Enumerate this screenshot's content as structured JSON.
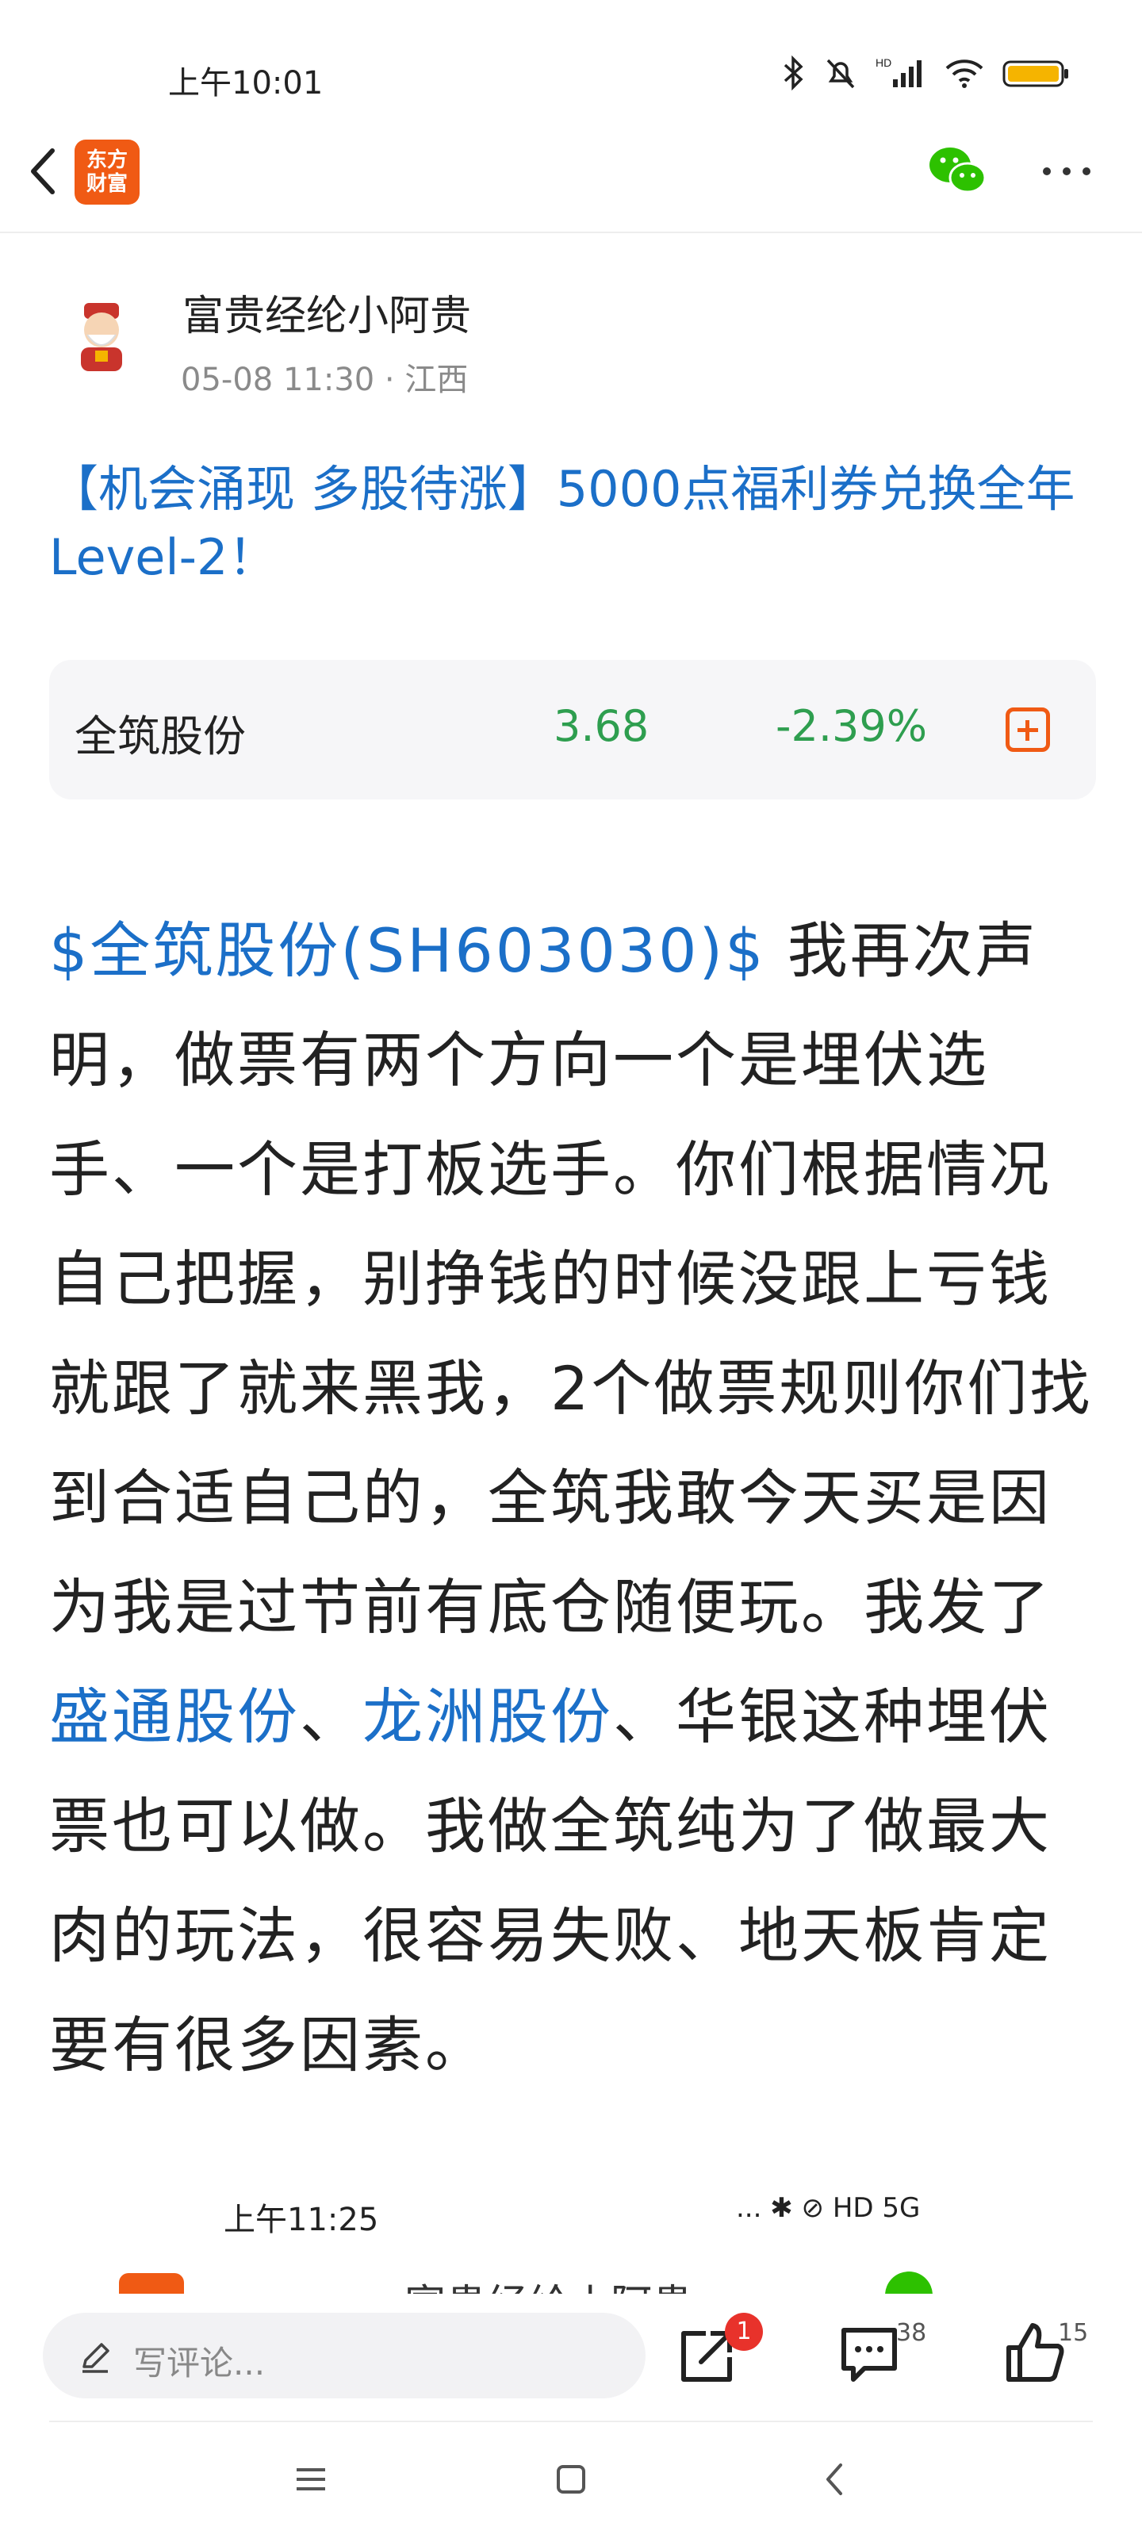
{
  "status_bar": {
    "time": "上午10:01",
    "network": "HD",
    "icons": [
      "bluetooth-icon",
      "mute-icon",
      "hd-icon",
      "signal-icon",
      "wifi-icon",
      "battery-icon"
    ]
  },
  "nav": {
    "logo_line1": "东方",
    "logo_line2": "财富",
    "icons": [
      "back-arrow-icon",
      "wechat-icon",
      "more-icon"
    ]
  },
  "post": {
    "author": "富贵经纶小阿贵",
    "meta": "05-08 11:30 · 江西",
    "promo_title": "【机会涌现 多股待涨】5000点福利券兑换全年Level-2！",
    "stock": {
      "name": "全筑股份",
      "price": "3.68",
      "change": "-2.39%",
      "change_color": "#2e9e4f"
    },
    "body": {
      "stock_link": "$全筑股份(SH603030)$",
      "text1": " 我再次声明，做票有两个方向一个是埋伏选手、一个是打板选手。你们根据情况自己把握，别挣钱的时候没跟上亏钱就跟了就来黑我，2个做票规则你们找到合适自己的，全筑我敢今天买是因为我是过节前有底仓随便玩。我发了",
      "link2": "盛通股份",
      "sep": "、",
      "link3": "龙洲股份",
      "text2": "、华银这种埋伏票也可以做。我做全筑纯为了做最大肉的玩法，很容易失败、地天板肯定要有很多因素。"
    }
  },
  "embedded_screenshot": {
    "time": "上午11:25",
    "icons_text": "... ✱ ⊘ HD 5G",
    "partial_text": "富贵经纶小阿贵"
  },
  "bottom_bar": {
    "comment_placeholder": "写评论...",
    "share_badge": "1",
    "comment_count": "38",
    "like_count": "15"
  },
  "colors": {
    "brand": "#f05a14",
    "link": "#1b6fc8",
    "down": "#2e9e4f"
  }
}
